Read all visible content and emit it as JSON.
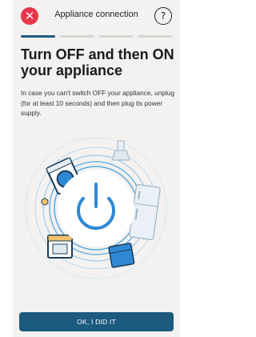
{
  "header": {
    "title": "Appliance connection",
    "close_icon": "close-icon",
    "help_icon": "help-icon",
    "close_glyph": "✕",
    "help_glyph": "?"
  },
  "progress": {
    "steps": 4,
    "current": 1
  },
  "content": {
    "headline": "Turn OFF and then ON your appliance",
    "description": "In case you can't switch OFF your appliance, unplug (for at least 10 seconds) and then plug its power supply."
  },
  "illustration": {
    "center_icon": "power-icon",
    "appliances": [
      "washing-machine-icon",
      "oven-icon",
      "dishwasher-icon",
      "fridge-icon",
      "dryer-icon",
      "hood-icon"
    ]
  },
  "actions": {
    "primary_label": "OK, I DID IT"
  },
  "colors": {
    "accent": "#1c5a7e",
    "close": "#e5364b",
    "ring": "#5aa9df",
    "background": "#f3f2f1"
  }
}
